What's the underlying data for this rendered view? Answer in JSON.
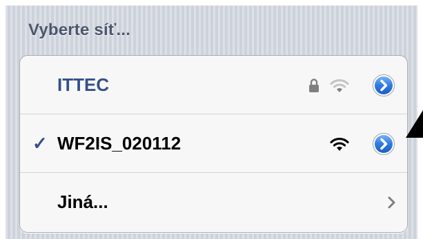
{
  "header": {
    "title": "Vyberte síť..."
  },
  "networks": [
    {
      "name": "ITTEC",
      "selected": false,
      "secured": true,
      "signal_bars": 1,
      "signal_max": 3,
      "icons": [
        "lock-icon",
        "wifi-icon",
        "detail-disclosure-icon"
      ]
    },
    {
      "name": "WF2IS_020112",
      "selected": true,
      "checkmark": "✓",
      "secured": false,
      "signal_bars": 3,
      "signal_max": 3,
      "icons": [
        "checkmark-icon",
        "wifi-icon",
        "detail-disclosure-icon"
      ]
    }
  ],
  "other": {
    "label": "Jiná...",
    "icon": "chevron-right-icon"
  },
  "colors": {
    "background": "#d5d9e2",
    "header_text": "#4c566c",
    "selected_accent": "#34508a",
    "disclosure_blue": "#2f7ae0",
    "chevron": "#7f7f7f"
  }
}
